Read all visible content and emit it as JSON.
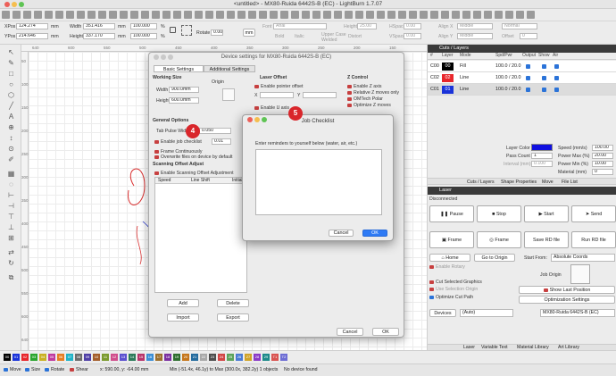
{
  "window": {
    "title": "<untitled> - MX80-Ruida 6442S-B (EC) - LightBurn 1.7.07"
  },
  "toolbar": {
    "xpos_label": "XPos",
    "xpos": "124.274",
    "ypos_label": "YPos",
    "ypos": "214.646",
    "unit_mm": "mm",
    "width_label": "Width",
    "width": "351.416",
    "height_label": "Height",
    "height": "337.170",
    "scale_w": "100.000",
    "scale_h": "100.000",
    "pct": "%",
    "rotate_label": "Rotate",
    "rotate": "0.00",
    "font_label": "Font",
    "font": "Arial",
    "size_label": "Height",
    "size": "25.00",
    "bold": "Bold",
    "italic": "Italic",
    "upper_case": "Upper Case",
    "welded": "Welded",
    "distort": "Distort",
    "hspace_label": "HSpace",
    "hspace": "0.00",
    "vspace_label": "VSpace",
    "vspace": "0.00",
    "align_x_label": "Align X",
    "align_x": "Middle",
    "align_y_label": "Align Y",
    "align_y": "Middle",
    "offset_label": "Offset",
    "offset": "0",
    "normal": "Normal"
  },
  "ruler": {
    "top": [
      "640",
      "600",
      "550",
      "500",
      "450",
      "400",
      "350",
      "300",
      "250",
      "200",
      "150"
    ],
    "left": [
      "50",
      "100",
      "150",
      "200",
      "250",
      "300",
      "350",
      "400",
      "450",
      "500",
      "550",
      "600",
      "640"
    ]
  },
  "cuts_panel": {
    "title": "Cuts / Layers",
    "columns": [
      "#",
      "Layer",
      "Mode",
      "Spd/Pwr",
      "Output",
      "Show",
      "Air"
    ],
    "rows": [
      {
        "num": "C00",
        "layer": "00",
        "mode": "Fill",
        "spdpwr": "100.0 / 20.0",
        "color": "#000000"
      },
      {
        "num": "C02",
        "layer": "02",
        "mode": "Line",
        "spdpwr": "100.0 / 20.0",
        "color": "#e8262b"
      },
      {
        "num": "C01",
        "layer": "01",
        "mode": "Line",
        "spdpwr": "100.0 / 20.0",
        "color": "#1a33d9"
      }
    ],
    "layer_color_label": "Layer Color",
    "layer_color": "#1010e0",
    "pass_count_label": "Pass Count",
    "pass_count": "1",
    "interval_label": "Interval (mm)",
    "interval": "0.100",
    "speed_label": "Speed (mm/s)",
    "speed": "100.00",
    "power_max_label": "Power Max (%)",
    "power_max": "20.00",
    "power_min_label": "Power Min (%)",
    "power_min": "10.00",
    "material_label": "Material (mm)",
    "material": "0",
    "tabs": [
      "Cuts / Layers",
      "Shape Properties",
      "Move",
      "File List"
    ]
  },
  "laser_panel": {
    "title": "Laser",
    "status": "Disconnected",
    "pause": "Pause",
    "stop": "Stop",
    "start": "Start",
    "send": "Send",
    "frame1": "Frame",
    "frame2": "Frame",
    "save_rd": "Save RD file",
    "run_rd": "Run RD file",
    "home": "Home",
    "go_origin": "Go to Origin",
    "start_from_label": "Start From:",
    "start_from": "Absolute Coords",
    "enable_rotary": "Enable Rotary",
    "job_origin_label": "Job Origin",
    "cut_selected": "Cut Selected Graphics",
    "use_selection_origin": "Use Selection Origin",
    "optimize_cut": "Optimize Cut Path",
    "show_last": "Show Last Position",
    "opt_settings": "Optimization Settings",
    "devices": "Devices",
    "devices_sel": "(Auto)",
    "device_name": "MX80-Ruida 6442S-B (EC)",
    "bottom_tabs": [
      "Laser",
      "Variable Text",
      "Material Library",
      "Art Library"
    ]
  },
  "device_dialog": {
    "title": "Device settings for MX80-Ruida 6442S-B (EC)",
    "tabs": [
      "Basic Settings",
      "Additional Settings"
    ],
    "working_size_label": "Working Size",
    "width_label": "Width",
    "width": "900.0mm",
    "height_label": "Height",
    "height": "600.0mm",
    "origin_label": "Origin",
    "laser_offset_label": "Laser Offset",
    "enable_pointer_offset": "Enable pointer offset",
    "x_label": "X",
    "y_label": "Y",
    "enable_u_axis": "Enable U axis",
    "z_control_label": "Z Control",
    "enable_z_axis": "Enable Z axis",
    "relative_z": "Relative Z moves only",
    "omtech_polar": "OMTech Polar",
    "optimize_z": "Optimize Z moves",
    "general_options_label": "General Options",
    "tab_pulse_label": "Tab Pulse Width",
    "tab_pulse": "0.050",
    "enable_job_checklist": "Enable job checklist",
    "checklist_val": "0.01",
    "frame_continuously": "Frame Continuously",
    "overwrite_files": "Overwrite files on device by default",
    "scanning_offset_label": "Scanning Offset Adjust",
    "enable_scanning_offset": "Enable Scanning Offset Adjustment",
    "table_cols": [
      "Speed",
      "Line Shift",
      "Initial"
    ],
    "add": "Add",
    "delete": "Delete",
    "import": "Import",
    "export": "Export",
    "cancel": "Cancel",
    "ok": "OK"
  },
  "checklist_dialog": {
    "title": "Job Checklist",
    "prompt": "Enter reminders to yourself below (water, air, etc.)",
    "text": "",
    "cancel": "Cancel",
    "ok": "OK"
  },
  "badges": {
    "b4": "4",
    "b5": "5"
  },
  "statusbar": {
    "move": "Move",
    "size": "Size",
    "rotate": "Rotate",
    "shear": "Shear",
    "coords": "x: 590.00, y: -64.00 mm",
    "minmax": "Min (-51.4x, 46.1y) to Max (300.0x, 382.2y)  1 objects",
    "device": "No device found"
  },
  "palette": {
    "labels": [
      "00",
      "01",
      "02",
      "03",
      "04",
      "05",
      "06",
      "07",
      "08",
      "09",
      "10",
      "11",
      "12",
      "13",
      "14",
      "15",
      "16",
      "17",
      "18",
      "19",
      "20",
      "21",
      "22",
      "23",
      "24",
      "25",
      "26",
      "27",
      "28",
      "29",
      "T1",
      "T2"
    ],
    "colors": [
      "#000000",
      "#1a33d9",
      "#e8262b",
      "#2aa52e",
      "#c9b020",
      "#c0399e",
      "#e67d21",
      "#1fb3c7",
      "#6b6b6b",
      "#4f3fa6",
      "#a35d2a",
      "#7a9a2d",
      "#d04e8c",
      "#5a4fcf",
      "#2c7a5a",
      "#b8336a",
      "#3b8ed6",
      "#9c6f2d",
      "#7b2fa0",
      "#2e6e2e",
      "#c5761b",
      "#246b9e",
      "#a8a8a8",
      "#4d4d4d",
      "#d24545",
      "#5ba35b",
      "#4a7bd4",
      "#cfa227",
      "#8a3ac7",
      "#1d8a8a",
      "#d9534f",
      "#6c6cd4"
    ]
  }
}
